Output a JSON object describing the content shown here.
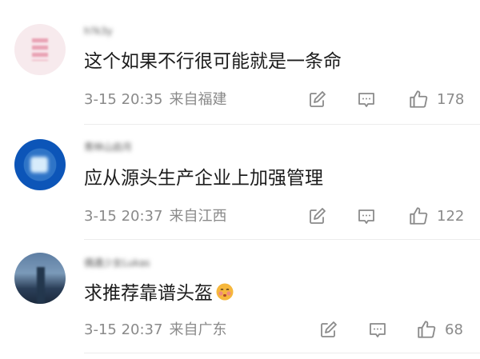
{
  "comments": [
    {
      "username": "h?k3y",
      "content": "这个如果不行很可能就是一条命",
      "time": "3-15 20:35",
      "location": "来自福建",
      "likes": "178",
      "avatar": "pink-blurred-avatar"
    },
    {
      "username": "青林山启月",
      "content": "应从源头生产企业上加强管理",
      "time": "3-15 20:37",
      "location": "来自江西",
      "likes": "122",
      "avatar": "blue-earth-avatar"
    },
    {
      "username": "偶遇少女Lukas",
      "content": "求推荐靠谱头盔",
      "emoji": "blushing-face-emoji",
      "time": "3-15 20:37",
      "location": "来自广东",
      "likes": "68",
      "avatar": "city-skyline-avatar"
    }
  ],
  "icons": {
    "share": "share-icon",
    "comment": "comment-icon",
    "like": "thumbs-up-icon"
  },
  "colors": {
    "text": "#1c1c1c",
    "meta": "#8a8a8a",
    "divider": "#ececec"
  }
}
